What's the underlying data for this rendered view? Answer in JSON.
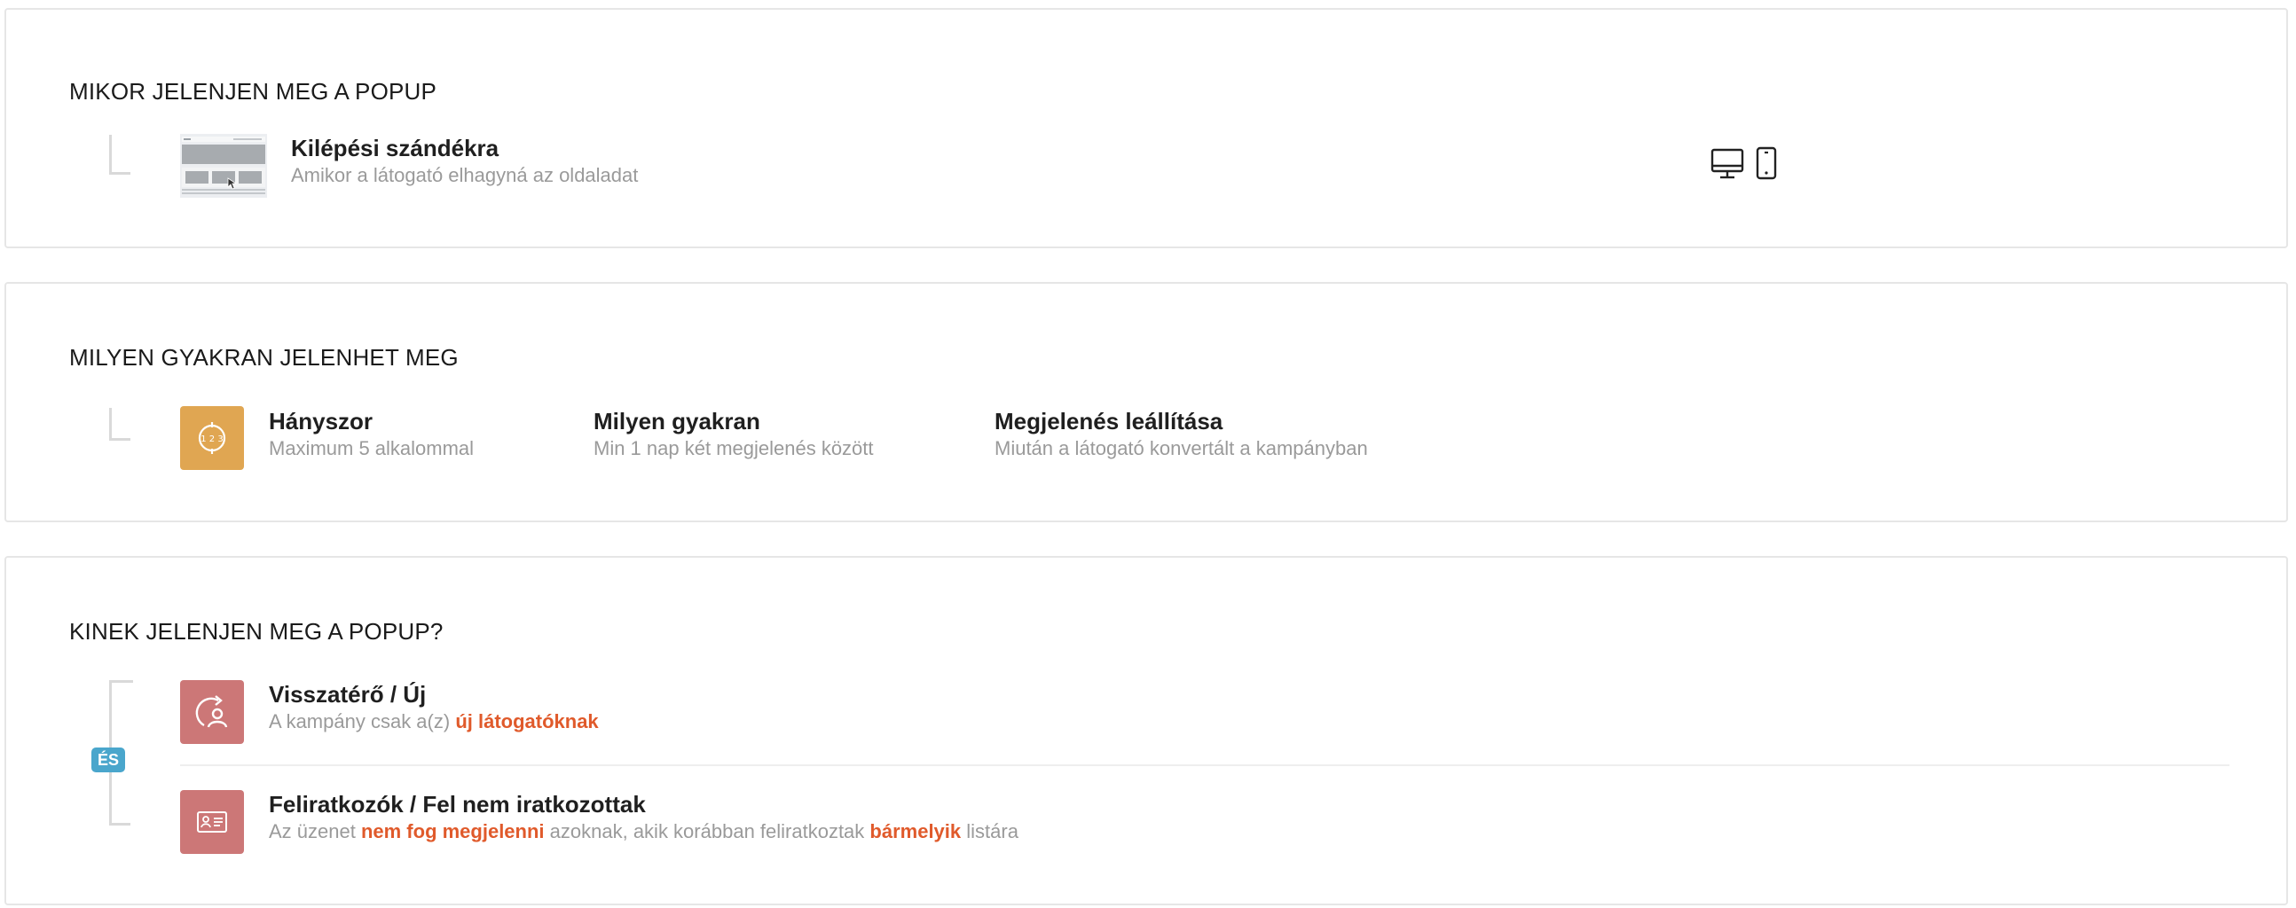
{
  "when": {
    "title": "MIKOR JELENJEN MEG A POPUP",
    "trigger": {
      "title": "Kilépési szándékra",
      "description": "Amikor a látogató elhagyná az oldaladat"
    },
    "devices": [
      "desktop-icon",
      "mobile-icon"
    ]
  },
  "frequency": {
    "title": "MILYEN GYAKRAN JELENHET MEG",
    "count": {
      "title": "Hányszor",
      "description": "Maximum 5 alkalommal"
    },
    "interval": {
      "title": "Milyen gyakran",
      "description": "Min 1 nap két megjelenés között"
    },
    "stop": {
      "title": "Megjelenés leállítása",
      "description": "Miután a látogató konvertált a kampányban"
    },
    "icon_text": "1 2 3",
    "icon_color": "#e0a652"
  },
  "audience": {
    "title": "KINEK JELENJEN MEG A POPUP?",
    "operator": "ÉS",
    "icon_color": "#cc7777",
    "highlight_color": "#e05a2b",
    "visitor": {
      "title": "Visszatérő / Új",
      "desc_prefix": "A kampány csak a(z) ",
      "desc_highlight": "új látogatóknak"
    },
    "subscribers": {
      "title": "Feliratkozók / Fel nem iratkozottak",
      "desc_part1": "Az üzenet ",
      "desc_highlight1": "nem fog megjelenni",
      "desc_part2": " azoknak, akik korábban feliratkoztak ",
      "desc_highlight2": "bármelyik",
      "desc_part3": " listára"
    }
  }
}
